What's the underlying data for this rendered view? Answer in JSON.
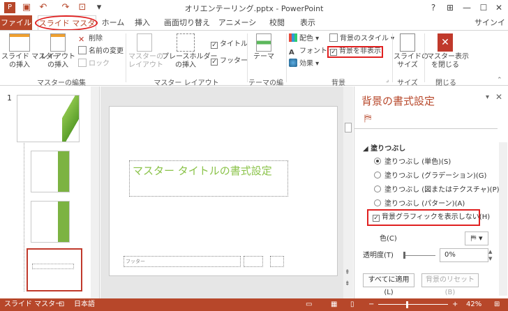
{
  "window": {
    "title": "オリエンテーリング.pptx - PowerPoint",
    "help": "?",
    "signin": "サインイン"
  },
  "tabs": [
    "ファイル",
    "スライド マスター",
    "ホーム",
    "挿入",
    "画面切り替え",
    "アニメーション",
    "校閲",
    "表示"
  ],
  "ribbon": {
    "edit_master": {
      "insert_master": "スライド マスター\nの挿入",
      "insert_layout": "レイアウト\nの挿入",
      "delete": "削除",
      "rename": "名前の変更",
      "lock": "ロック",
      "label": "マスターの編集"
    },
    "layout": {
      "master_layout": "マスターの\nレイアウト",
      "placeholder": "プレースホルダー\nの挿入",
      "title_cb": "タイトル",
      "footer_cb": "フッター",
      "label": "マスター レイアウト"
    },
    "theme": {
      "theme": "テーマ",
      "label": "テーマの編集"
    },
    "background": {
      "colors": "配色",
      "fonts": "フォント",
      "effects": "効果",
      "bg_styles": "背景のスタイル",
      "hide_bg": "背景を非表示",
      "label": "背景"
    },
    "size": {
      "slide_size": "スライドの\nサイズ",
      "label": "サイズ"
    },
    "close": {
      "close_master": "マスター表示\nを閉じる",
      "label": "閉じる"
    }
  },
  "thumbs": {
    "number": "1"
  },
  "slide": {
    "title_placeholder": "マスター タイトルの書式設定",
    "footer": "フッター"
  },
  "format_pane": {
    "title": "背景の書式設定",
    "section": "塗りつぶし",
    "options": [
      "塗りつぶし (単色)(S)",
      "塗りつぶし (グラデーション)(G)",
      "塗りつぶし (図またはテクスチャ)(P)",
      "塗りつぶし (パターン)(A)"
    ],
    "selected": 0,
    "hide_graphics": "背景グラフィックを表示しない(H)",
    "color_label": "色(C)",
    "transparency_label": "透明度(T)",
    "transparency_value": "0%",
    "apply_all": "すべてに適用(L)",
    "reset": "背景のリセット(B)"
  },
  "status": {
    "view": "スライド マスター",
    "language": "日本語",
    "zoom": "42%"
  },
  "colors": {
    "accent": "#b7472a",
    "highlight": "#e02020",
    "title_green": "#8bc34a"
  }
}
